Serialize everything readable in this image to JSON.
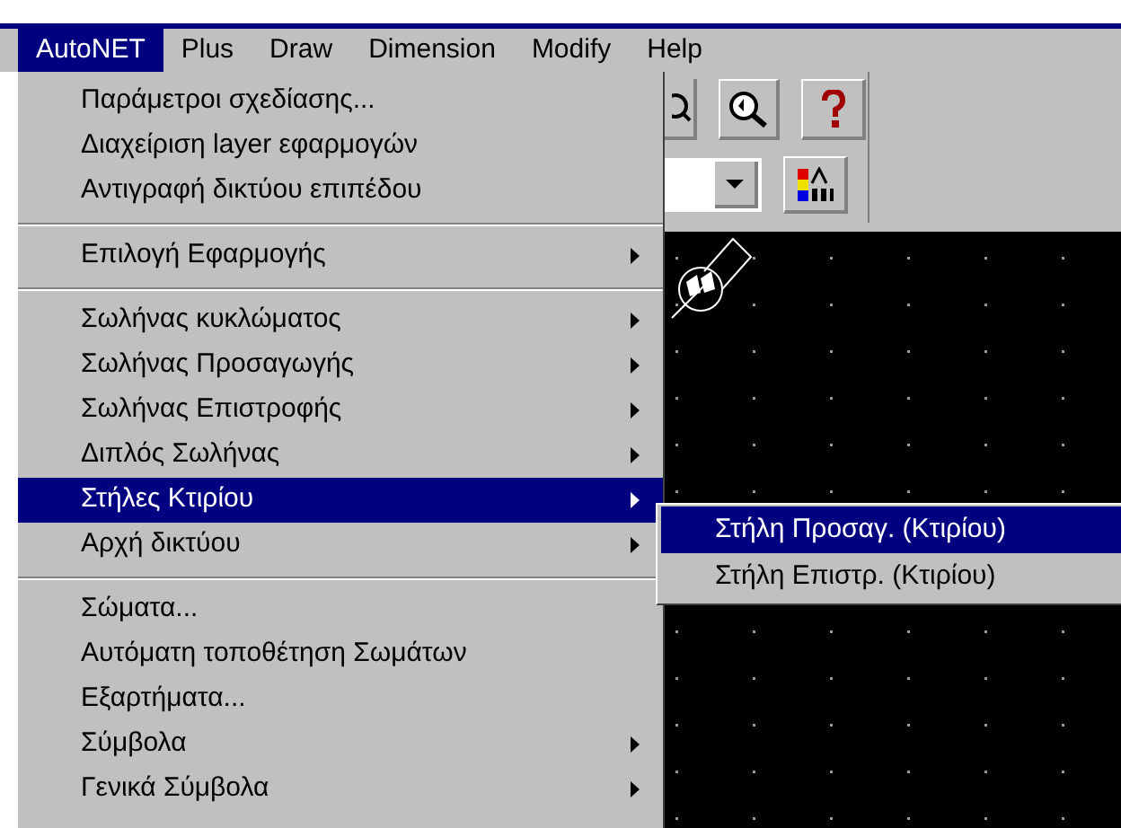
{
  "menubar": [
    {
      "label": "AutoNET",
      "selected": true
    },
    {
      "label": "Plus",
      "selected": false
    },
    {
      "label": "Draw",
      "selected": false
    },
    {
      "label": "Dimension",
      "selected": false
    },
    {
      "label": "Modify",
      "selected": false
    },
    {
      "label": "Help",
      "selected": false
    }
  ],
  "menu": [
    {
      "kind": "item",
      "label": "Παράμετροι σχεδίασης...",
      "submenu": false,
      "selected": false
    },
    {
      "kind": "item",
      "label": "Διαχείριση layer εφαρμογών",
      "submenu": false,
      "selected": false
    },
    {
      "kind": "item",
      "label": "Αντιγραφή δικτύου επιπέδου",
      "submenu": false,
      "selected": false
    },
    {
      "kind": "separator"
    },
    {
      "kind": "item",
      "label": "Επιλογή Εφαρμογής",
      "submenu": true,
      "selected": false
    },
    {
      "kind": "separator"
    },
    {
      "kind": "item",
      "label": "Σωλήνας κυκλώματος",
      "submenu": true,
      "selected": false
    },
    {
      "kind": "item",
      "label": "Σωλήνας Προσαγωγής",
      "submenu": true,
      "selected": false
    },
    {
      "kind": "item",
      "label": "Σωλήνας Επιστροφής",
      "submenu": true,
      "selected": false
    },
    {
      "kind": "item",
      "label": "Διπλός Σωλήνας",
      "submenu": true,
      "selected": false
    },
    {
      "kind": "item",
      "label": "Στήλες Κτιρίου",
      "submenu": true,
      "selected": true
    },
    {
      "kind": "item",
      "label": "Αρχή δικτύου",
      "submenu": true,
      "selected": false
    },
    {
      "kind": "separator"
    },
    {
      "kind": "item",
      "label": "Σώματα...",
      "submenu": false,
      "selected": false
    },
    {
      "kind": "item",
      "label": "Αυτόματη τοποθέτηση Σωμάτων",
      "submenu": false,
      "selected": false
    },
    {
      "kind": "item",
      "label": "Εξαρτήματα...",
      "submenu": false,
      "selected": false
    },
    {
      "kind": "item",
      "label": "Σύμβολα",
      "submenu": true,
      "selected": false
    },
    {
      "kind": "item",
      "label": "Γενικά Σύμβολα",
      "submenu": true,
      "selected": false
    }
  ],
  "submenu": [
    {
      "label": "Στήλη Προσαγ. (Κτιρίου)",
      "selected": true
    },
    {
      "label": "Στήλη Επιστρ. (Κτιρίου)",
      "selected": false
    }
  ]
}
